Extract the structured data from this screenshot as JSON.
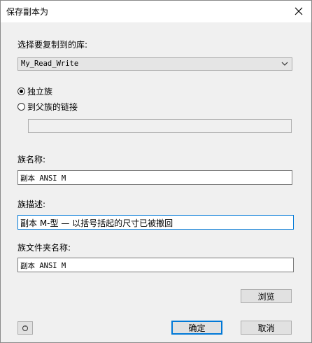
{
  "window": {
    "title": "保存副本为",
    "close_icon": "close-icon"
  },
  "library": {
    "label": "选择要复制到的库:",
    "selected": "My_Read_Write",
    "dropdown_icon": "chevron-down-icon"
  },
  "options": {
    "radio_family": "独立族",
    "radio_parent_link": "到父族的链接",
    "selected": "独立族"
  },
  "family_name": {
    "label": "族名称:",
    "value": "副本 ANSI M"
  },
  "family_description": {
    "label": "族描述:",
    "value": "副本 M-型 — 以括号括起的尺寸已被撤回"
  },
  "family_folder": {
    "label": "族文件夹名称:",
    "value": "副本 ANSI M"
  },
  "buttons": {
    "browse": "浏览",
    "ok": "确定",
    "cancel": "取消",
    "help_icon": "help-icon"
  }
}
